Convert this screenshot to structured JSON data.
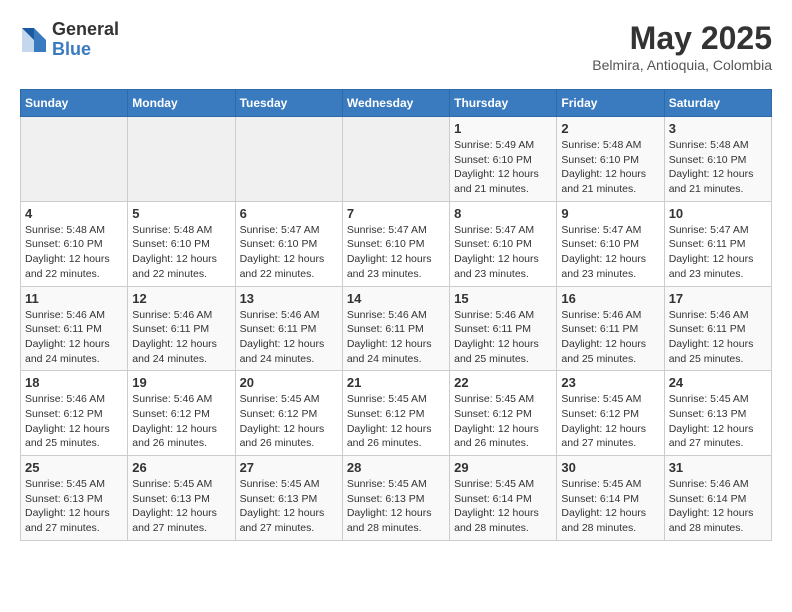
{
  "header": {
    "logo_general": "General",
    "logo_blue": "Blue",
    "month_year": "May 2025",
    "location": "Belmira, Antioquia, Colombia"
  },
  "weekdays": [
    "Sunday",
    "Monday",
    "Tuesday",
    "Wednesday",
    "Thursday",
    "Friday",
    "Saturday"
  ],
  "weeks": [
    [
      {
        "day": "",
        "info": ""
      },
      {
        "day": "",
        "info": ""
      },
      {
        "day": "",
        "info": ""
      },
      {
        "day": "",
        "info": ""
      },
      {
        "day": "1",
        "info": "Sunrise: 5:49 AM\nSunset: 6:10 PM\nDaylight: 12 hours\nand 21 minutes."
      },
      {
        "day": "2",
        "info": "Sunrise: 5:48 AM\nSunset: 6:10 PM\nDaylight: 12 hours\nand 21 minutes."
      },
      {
        "day": "3",
        "info": "Sunrise: 5:48 AM\nSunset: 6:10 PM\nDaylight: 12 hours\nand 21 minutes."
      }
    ],
    [
      {
        "day": "4",
        "info": "Sunrise: 5:48 AM\nSunset: 6:10 PM\nDaylight: 12 hours\nand 22 minutes."
      },
      {
        "day": "5",
        "info": "Sunrise: 5:48 AM\nSunset: 6:10 PM\nDaylight: 12 hours\nand 22 minutes."
      },
      {
        "day": "6",
        "info": "Sunrise: 5:47 AM\nSunset: 6:10 PM\nDaylight: 12 hours\nand 22 minutes."
      },
      {
        "day": "7",
        "info": "Sunrise: 5:47 AM\nSunset: 6:10 PM\nDaylight: 12 hours\nand 23 minutes."
      },
      {
        "day": "8",
        "info": "Sunrise: 5:47 AM\nSunset: 6:10 PM\nDaylight: 12 hours\nand 23 minutes."
      },
      {
        "day": "9",
        "info": "Sunrise: 5:47 AM\nSunset: 6:10 PM\nDaylight: 12 hours\nand 23 minutes."
      },
      {
        "day": "10",
        "info": "Sunrise: 5:47 AM\nSunset: 6:11 PM\nDaylight: 12 hours\nand 23 minutes."
      }
    ],
    [
      {
        "day": "11",
        "info": "Sunrise: 5:46 AM\nSunset: 6:11 PM\nDaylight: 12 hours\nand 24 minutes."
      },
      {
        "day": "12",
        "info": "Sunrise: 5:46 AM\nSunset: 6:11 PM\nDaylight: 12 hours\nand 24 minutes."
      },
      {
        "day": "13",
        "info": "Sunrise: 5:46 AM\nSunset: 6:11 PM\nDaylight: 12 hours\nand 24 minutes."
      },
      {
        "day": "14",
        "info": "Sunrise: 5:46 AM\nSunset: 6:11 PM\nDaylight: 12 hours\nand 24 minutes."
      },
      {
        "day": "15",
        "info": "Sunrise: 5:46 AM\nSunset: 6:11 PM\nDaylight: 12 hours\nand 25 minutes."
      },
      {
        "day": "16",
        "info": "Sunrise: 5:46 AM\nSunset: 6:11 PM\nDaylight: 12 hours\nand 25 minutes."
      },
      {
        "day": "17",
        "info": "Sunrise: 5:46 AM\nSunset: 6:11 PM\nDaylight: 12 hours\nand 25 minutes."
      }
    ],
    [
      {
        "day": "18",
        "info": "Sunrise: 5:46 AM\nSunset: 6:12 PM\nDaylight: 12 hours\nand 25 minutes."
      },
      {
        "day": "19",
        "info": "Sunrise: 5:46 AM\nSunset: 6:12 PM\nDaylight: 12 hours\nand 26 minutes."
      },
      {
        "day": "20",
        "info": "Sunrise: 5:45 AM\nSunset: 6:12 PM\nDaylight: 12 hours\nand 26 minutes."
      },
      {
        "day": "21",
        "info": "Sunrise: 5:45 AM\nSunset: 6:12 PM\nDaylight: 12 hours\nand 26 minutes."
      },
      {
        "day": "22",
        "info": "Sunrise: 5:45 AM\nSunset: 6:12 PM\nDaylight: 12 hours\nand 26 minutes."
      },
      {
        "day": "23",
        "info": "Sunrise: 5:45 AM\nSunset: 6:12 PM\nDaylight: 12 hours\nand 27 minutes."
      },
      {
        "day": "24",
        "info": "Sunrise: 5:45 AM\nSunset: 6:13 PM\nDaylight: 12 hours\nand 27 minutes."
      }
    ],
    [
      {
        "day": "25",
        "info": "Sunrise: 5:45 AM\nSunset: 6:13 PM\nDaylight: 12 hours\nand 27 minutes."
      },
      {
        "day": "26",
        "info": "Sunrise: 5:45 AM\nSunset: 6:13 PM\nDaylight: 12 hours\nand 27 minutes."
      },
      {
        "day": "27",
        "info": "Sunrise: 5:45 AM\nSunset: 6:13 PM\nDaylight: 12 hours\nand 27 minutes."
      },
      {
        "day": "28",
        "info": "Sunrise: 5:45 AM\nSunset: 6:13 PM\nDaylight: 12 hours\nand 28 minutes."
      },
      {
        "day": "29",
        "info": "Sunrise: 5:45 AM\nSunset: 6:14 PM\nDaylight: 12 hours\nand 28 minutes."
      },
      {
        "day": "30",
        "info": "Sunrise: 5:45 AM\nSunset: 6:14 PM\nDaylight: 12 hours\nand 28 minutes."
      },
      {
        "day": "31",
        "info": "Sunrise: 5:46 AM\nSunset: 6:14 PM\nDaylight: 12 hours\nand 28 minutes."
      }
    ]
  ]
}
